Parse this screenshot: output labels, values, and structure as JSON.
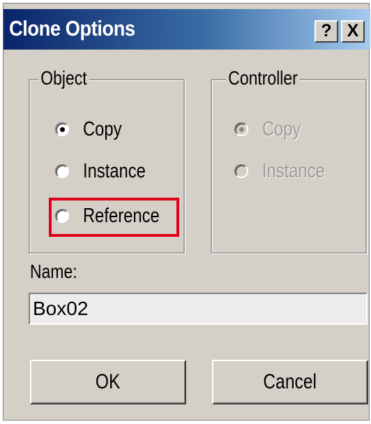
{
  "window": {
    "title": "Clone Options",
    "help_label": "?",
    "close_label": "X"
  },
  "object_group": {
    "label": "Object",
    "options": [
      {
        "label": "Copy",
        "checked": true
      },
      {
        "label": "Instance",
        "checked": false
      },
      {
        "label": "Reference",
        "checked": false
      }
    ]
  },
  "controller_group": {
    "label": "Controller",
    "disabled": true,
    "options": [
      {
        "label": "Copy",
        "checked": true
      },
      {
        "label": "Instance",
        "checked": false
      }
    ]
  },
  "name": {
    "label": "Name:",
    "value": "Box02"
  },
  "buttons": {
    "ok": "OK",
    "cancel": "Cancel"
  },
  "colors": {
    "highlight": "#e0001a",
    "titlebar_start": "#0a246a",
    "titlebar_end": "#a6caf0",
    "dialog_bg": "#d4d0c8"
  }
}
